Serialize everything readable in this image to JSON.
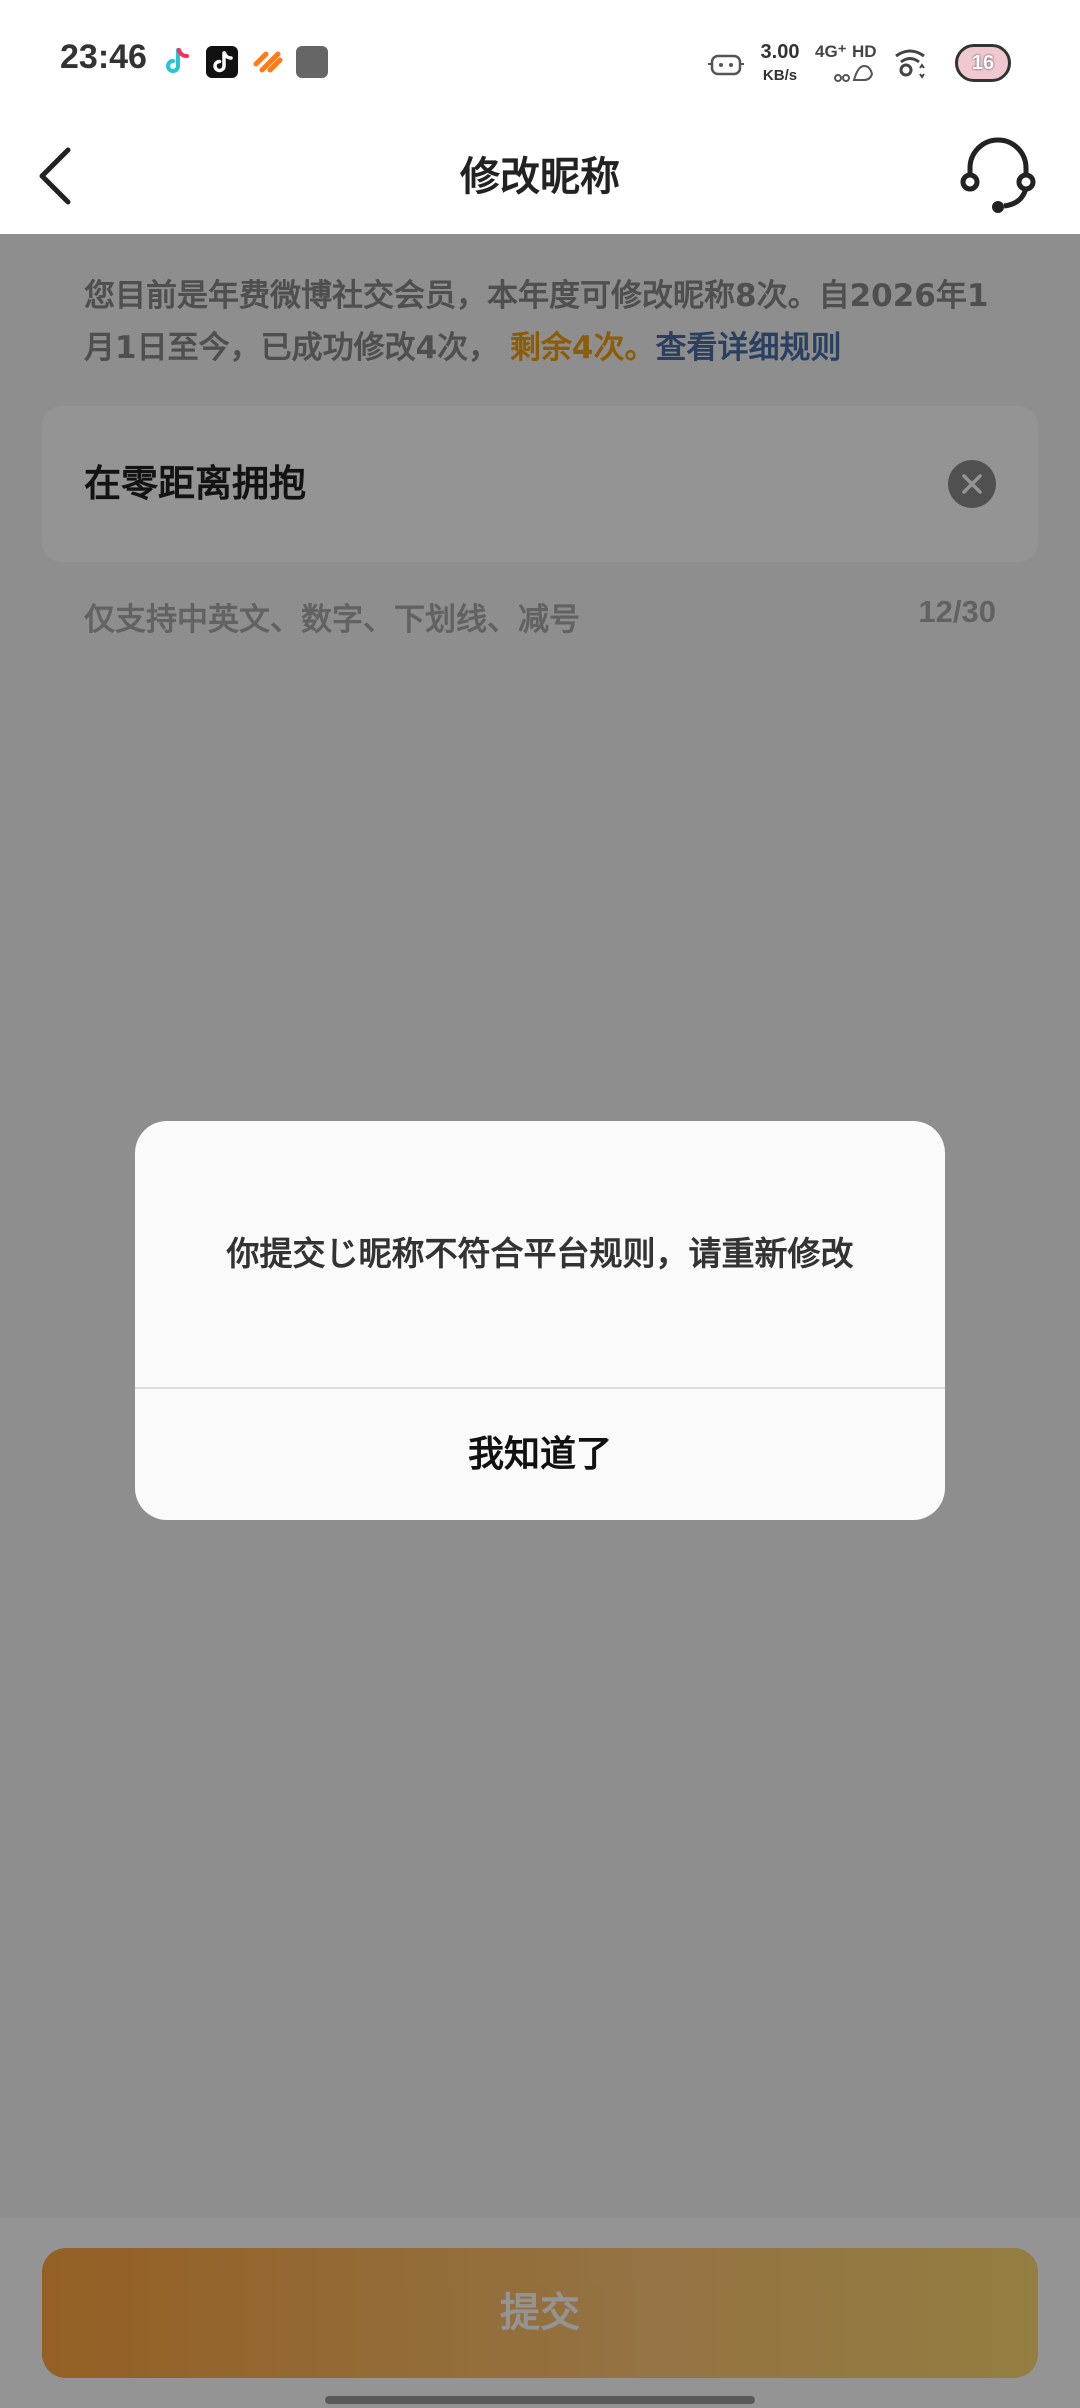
{
  "status_bar": {
    "time": "23:46",
    "net_speed_value": "3.00",
    "net_speed_unit": "KB/s",
    "network_label": "4G⁺",
    "hd_label": "HD",
    "battery_level": "16",
    "app_icons": [
      "tiktok-lite-icon",
      "tiktok-icon",
      "huoshan-icon",
      "app-icon"
    ]
  },
  "header": {
    "title": "修改昵称",
    "back_icon": "chevron-left-icon",
    "support_icon": "headset-icon"
  },
  "notice": {
    "text_part1": "您目前是年费微博社交会员，本年度可修改昵称8次。自2026年1月1日至今，已成功修改4次，",
    "remaining": "剩余4次。",
    "rules_link": "查看详细规则"
  },
  "nickname_field": {
    "value": "在零距离拥抱",
    "clear_icon": "clear-circle-icon"
  },
  "hint": {
    "text": "仅支持中英文、数字、下划线、减号",
    "counter": "12/30"
  },
  "submit": {
    "label": "提交"
  },
  "dialog": {
    "message": "你提交じ昵称不符合平台规则，请重新修改",
    "confirm_label": "我知道了"
  },
  "colors": {
    "accent_orange": "#ff8800",
    "highlight_orange": "#f0a010",
    "link_blue": "#4a6fa5"
  }
}
